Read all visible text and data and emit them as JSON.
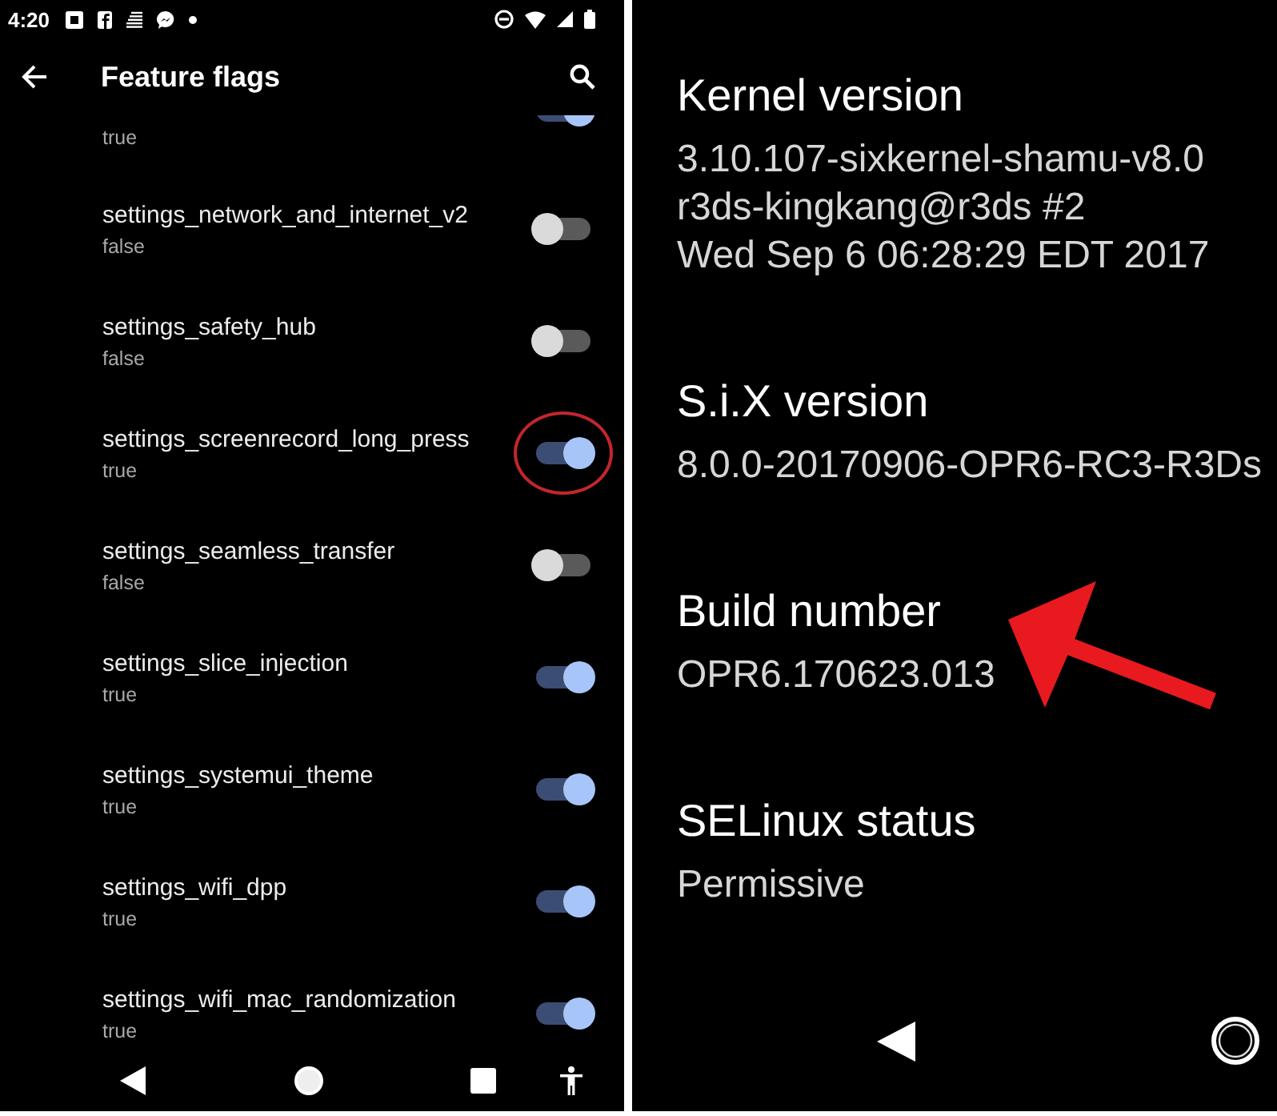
{
  "left_screen": {
    "status_bar": {
      "time": "4:20"
    },
    "app_bar": {
      "title": "Feature flags"
    },
    "partial_item": {
      "value": "true",
      "on": true
    },
    "flags": [
      {
        "name": "settings_network_and_internet_v2",
        "value": "false",
        "on": false,
        "circled": false
      },
      {
        "name": "settings_safety_hub",
        "value": "false",
        "on": false,
        "circled": false
      },
      {
        "name": "settings_screenrecord_long_press",
        "value": "true",
        "on": true,
        "circled": true
      },
      {
        "name": "settings_seamless_transfer",
        "value": "false",
        "on": false,
        "circled": false
      },
      {
        "name": "settings_slice_injection",
        "value": "true",
        "on": true,
        "circled": false
      },
      {
        "name": "settings_systemui_theme",
        "value": "true",
        "on": true,
        "circled": false
      },
      {
        "name": "settings_wifi_dpp",
        "value": "true",
        "on": true,
        "circled": false
      },
      {
        "name": "settings_wifi_mac_randomization",
        "value": "true",
        "on": true,
        "circled": false
      }
    ]
  },
  "right_screen": {
    "sections": [
      {
        "title": "Kernel version",
        "lines": [
          "3.10.107-sixkernel-shamu-v8.0",
          "r3ds-kingkang@r3ds #2",
          "Wed Sep 6 06:28:29 EDT 2017"
        ],
        "arrow": false
      },
      {
        "title": "S.i.X version",
        "lines": [
          "8.0.0-20170906-OPR6-RC3-R3Ds"
        ],
        "arrow": false
      },
      {
        "title": "Build number",
        "lines": [
          "OPR6.170623.013"
        ],
        "arrow": true
      },
      {
        "title": "SELinux status",
        "lines": [
          "Permissive"
        ],
        "arrow": false
      }
    ]
  }
}
